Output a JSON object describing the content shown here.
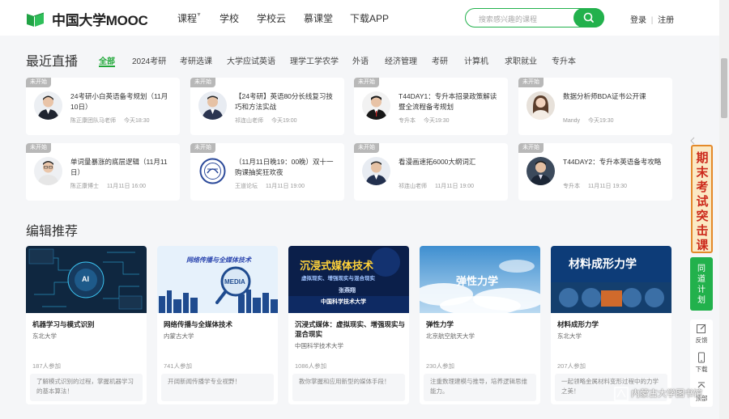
{
  "header": {
    "logo_text": "中国大学MOOC",
    "nav": [
      "课程",
      "学校",
      "学校云",
      "慕课堂",
      "下载APP"
    ],
    "search_placeholder": "搜索感兴趣的课程",
    "login": "登录",
    "separator": "|",
    "register": "注册"
  },
  "live": {
    "title": "最近直播",
    "tabs": [
      "全部",
      "2024考研",
      "考研选课",
      "大学应试英语",
      "理学工学农学",
      "外语",
      "经济管理",
      "考研",
      "计算机",
      "求职就业",
      "专升本"
    ],
    "items": [
      {
        "badge": "未开始",
        "title": "24考研小白英语备考规划（11月10日）",
        "author": "陈正康团队马老师",
        "time": "今天18:30"
      },
      {
        "badge": "未开始",
        "title": "【24考研】英语80分长线复习技巧和方法实战",
        "author": "祁连山老师",
        "time": "今天19:00"
      },
      {
        "badge": "未开始",
        "title": "T44DAY1：专升本招录政策解读暨全流程备考规划",
        "author": "专升本",
        "time": "今天19:30"
      },
      {
        "badge": "未开始",
        "title": "数据分析师BDA证书公开课",
        "author": "Mandy",
        "time": "今天19:30"
      },
      {
        "badge": "未开始",
        "title": "单词量暴涨的底层逻辑（11月11日）",
        "author": "陈正康博士",
        "time": "11月11日 16:00"
      },
      {
        "badge": "未开始",
        "title": "（11月11日晚19：00晚）双十一购课抽奖狂欢夜",
        "author": "王道论坛",
        "time": "11月11日 19:00"
      },
      {
        "badge": "未开始",
        "title": "看漫画速拓6000大纲词汇",
        "author": "祁连山老师",
        "time": "11月11日 19:00"
      },
      {
        "badge": "未开始",
        "title": "T44DAY2：专升本英语备考攻略",
        "author": "专升本",
        "time": "11月11日 19:30"
      }
    ]
  },
  "editor": {
    "title": "编辑推荐",
    "courses": [
      {
        "title": "机器学习与模式识别",
        "school": "东北大学",
        "count": "187人参加",
        "desc": "了解模式识别的过程，掌握机器学习的基本算法！",
        "cover_text": [
          "AI"
        ]
      },
      {
        "title": "网络传播与全媒体技术",
        "school": "内蒙古大学",
        "count": "741人参加",
        "desc": "开阔新闻传播学专业视野！",
        "cover_text": [
          "网络传播与全媒体技术",
          "MEDIA"
        ]
      },
      {
        "title": "沉浸式媒体：虚拟现实、增强现实与混合现实",
        "school": "中国科学技术大学",
        "count": "1086人参加",
        "desc": "教你掌握和应用新型的媒体手段！",
        "cover_text": [
          "沉浸式媒体技术",
          "虚拟现实、增强现实与混合现实",
          "张燕翔",
          "中国科学技术大学"
        ]
      },
      {
        "title": "弹性力学",
        "school": "北京航空航天大学",
        "count": "230人参加",
        "desc": "注重数理建模与推导，培养逻辑思维能力。",
        "cover_text": [
          "弹性力学"
        ]
      },
      {
        "title": "材料成形力学",
        "school": "东北大学",
        "count": "207人参加",
        "desc": "一起领略金属材料变形过程中的力学之美！",
        "cover_text": [
          "材料成形力学"
        ]
      }
    ]
  },
  "sidebar": {
    "promo_text": "期末考试突击课",
    "plan_text": "同道计划",
    "feedback": "反馈",
    "download": "下载",
    "top": "顶部"
  },
  "watermark": "内蒙古大学图书馆",
  "colors": {
    "brand_green": "#22b14c",
    "tab_active": "#22a83a",
    "badge_gray": "#b8b8b8"
  }
}
